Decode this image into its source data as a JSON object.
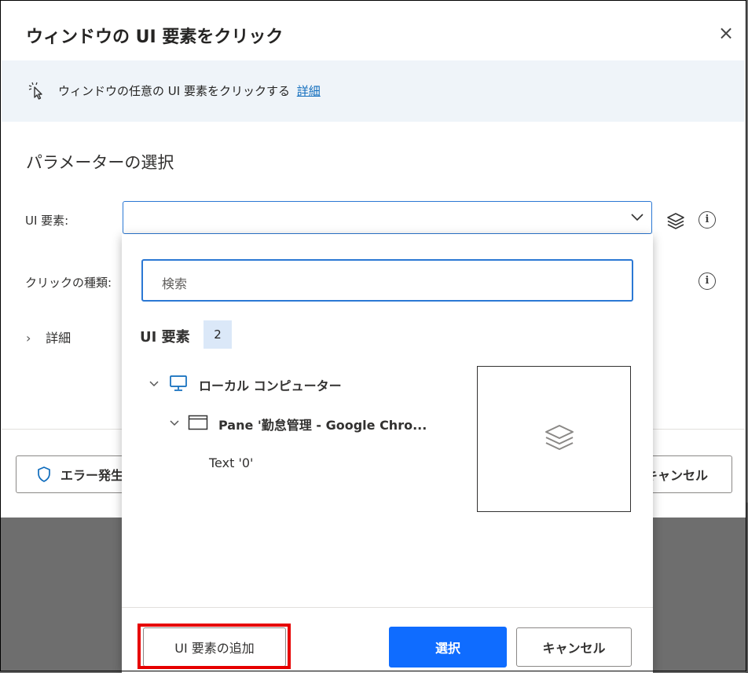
{
  "dialog": {
    "title": "ウィンドウの UI 要素をクリック",
    "close_glyph": "×"
  },
  "banner": {
    "text": "ウィンドウの任意の UI 要素をクリックする",
    "link": "詳細"
  },
  "params": {
    "section_title": "パラメーターの選択",
    "ui_element_label": "UI 要素:",
    "click_type_label": "クリックの種類:",
    "details_label": "詳細"
  },
  "footer": {
    "error_button": "エラー発生",
    "cancel_button": "キャンセル"
  },
  "dropdown": {
    "search_placeholder": "検索",
    "header": "UI 要素",
    "count": "2",
    "tree": {
      "computer": "ローカル コンピューター",
      "pane": "Pane '勤怠管理 - Google Chro...",
      "text_item": "Text '0'"
    },
    "add_button": "UI 要素の追加",
    "select_button": "選択",
    "cancel_button": "キャンセル"
  },
  "colors": {
    "accent": "#0f6cff",
    "link": "#0f6cbd",
    "banner_bg": "#eff4f9",
    "highlight": "#e60000"
  }
}
